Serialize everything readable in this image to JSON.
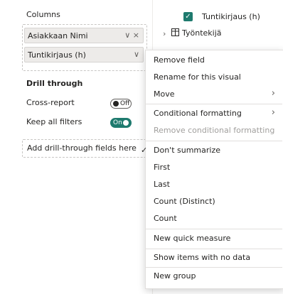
{
  "columns_section": {
    "title": "Columns",
    "fields": [
      {
        "label": "Asiakkaan Nimi",
        "icons": "∨ ×"
      },
      {
        "label": "Tuntikirjaus (h)",
        "icons": "∨"
      }
    ]
  },
  "drill_through": {
    "title": "Drill through",
    "cross_report": {
      "label": "Cross-report",
      "state_text": "Off",
      "state": "off"
    },
    "keep_all_filters": {
      "label": "Keep all filters",
      "state_text": "On",
      "state": "on"
    },
    "add_fields_placeholder": "Add drill-through fields here"
  },
  "fields_pane": {
    "checked_field": "Tuntikirjaus (h)",
    "table_name": "Työntekijä",
    "table_icon": "table-icon"
  },
  "context_menu": {
    "items": [
      {
        "label": "Remove field",
        "disabled": false,
        "submenu": false,
        "checked": false
      },
      {
        "label": "Rename for this visual",
        "disabled": false,
        "submenu": false,
        "checked": false
      },
      {
        "label": "Move",
        "disabled": false,
        "submenu": true,
        "checked": false
      },
      {
        "label": "Conditional formatting",
        "disabled": false,
        "submenu": true,
        "checked": false
      },
      {
        "label": "Remove conditional formatting",
        "disabled": true,
        "submenu": false,
        "checked": false
      },
      {
        "label": "Don't summarize",
        "disabled": false,
        "submenu": false,
        "checked": true
      },
      {
        "label": "First",
        "disabled": false,
        "submenu": false,
        "checked": false
      },
      {
        "label": "Last",
        "disabled": false,
        "submenu": false,
        "checked": false
      },
      {
        "label": "Count (Distinct)",
        "disabled": false,
        "submenu": false,
        "checked": false
      },
      {
        "label": "Count",
        "disabled": false,
        "submenu": false,
        "checked": false
      },
      {
        "label": "New quick measure",
        "disabled": false,
        "submenu": false,
        "checked": false
      },
      {
        "label": "Show items with no data",
        "disabled": false,
        "submenu": false,
        "checked": false
      },
      {
        "label": "New group",
        "disabled": false,
        "submenu": false,
        "checked": false
      }
    ]
  },
  "colors": {
    "accent": "#1e7a6e",
    "disabled_text": "#a19f9d",
    "pill_bg": "#edebe9"
  }
}
